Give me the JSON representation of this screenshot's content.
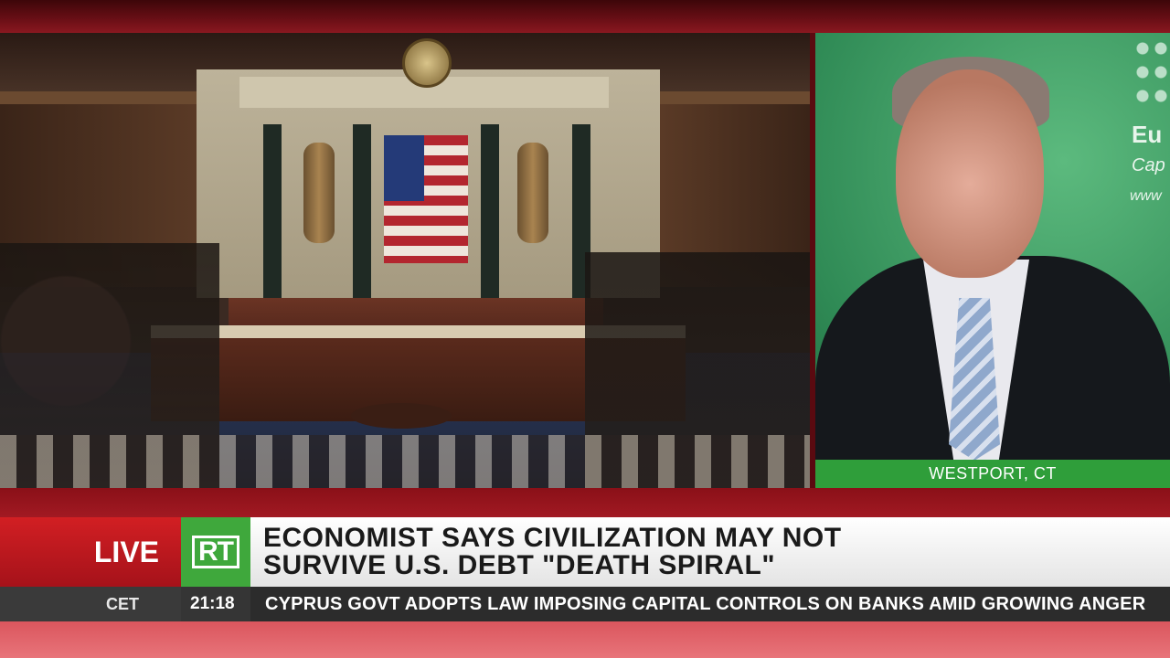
{
  "location": "WESTPORT, CT",
  "guest_backdrop": {
    "logo_text": "Eu",
    "logo_sub": "Cap",
    "logo_url": "www"
  },
  "live_label": "LIVE",
  "channel_logo": "RT",
  "headline": {
    "line1": "ECONOMIST SAYS CIVILIZATION MAY NOT",
    "line2": "SURVIVE U.S. DEBT \"DEATH SPIRAL\""
  },
  "ticker": {
    "timezone": "CET",
    "time": "21:18",
    "text": "CYPRUS GOVT ADOPTS LAW IMPOSING CAPITAL CONTROLS ON BANKS AMID GROWING ANGER"
  },
  "colors": {
    "live_red": "#d21f23",
    "rt_green": "#3fa83c",
    "location_green": "#2f9e3a"
  }
}
